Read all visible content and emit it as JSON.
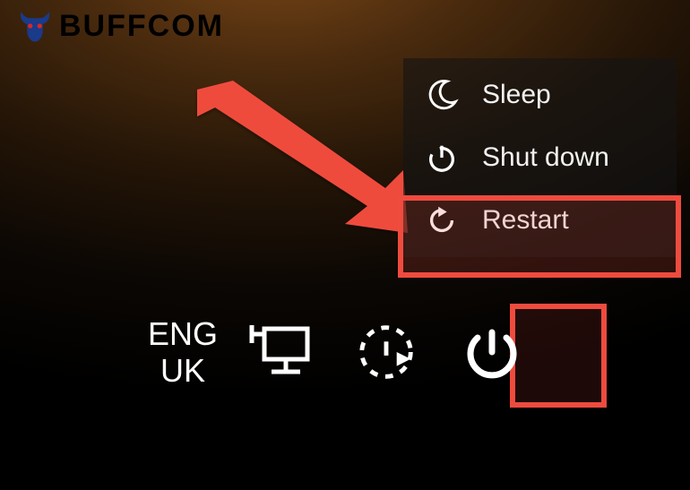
{
  "logo": {
    "text": "BUFFCOM"
  },
  "power_menu": {
    "items": [
      {
        "label": "Sleep",
        "icon": "moon-icon"
      },
      {
        "label": "Shut down",
        "icon": "power-icon"
      },
      {
        "label": "Restart",
        "icon": "restart-icon"
      }
    ]
  },
  "taskbar": {
    "language": {
      "line1": "ENG",
      "line2": "UK"
    }
  },
  "annotations": {
    "arrow_color": "#ef4b3e",
    "highlight_color": "#ef4b3e"
  }
}
